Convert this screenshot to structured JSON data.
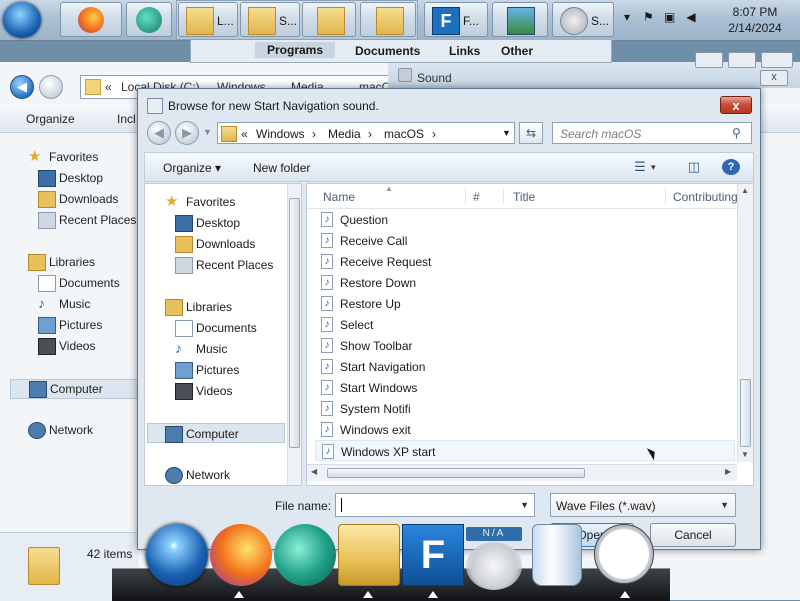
{
  "taskbar": {
    "buttons": [
      {
        "label": "L...",
        "icon": "folder-icon"
      },
      {
        "label": "S...",
        "icon": "folder-icon"
      },
      {
        "label": "",
        "icon": "folder-icon"
      },
      {
        "label": "",
        "icon": "folder-icon"
      },
      {
        "label": "F...",
        "icon": "app-f-icon"
      },
      {
        "label": "",
        "icon": "display-icon"
      },
      {
        "label": "S...",
        "icon": "speaker-icon"
      }
    ],
    "clock": {
      "time": "8:07 PM",
      "date": "2/14/2024"
    }
  },
  "jumpbar": {
    "items": [
      "Programs",
      "Documents",
      "Links",
      "Other"
    ]
  },
  "background_window": {
    "address": [
      "«",
      "Local Disk (C:)",
      "›",
      "Windows",
      "›",
      "Media",
      "›",
      "macOS"
    ],
    "toolbar": [
      "Organize",
      "Incl"
    ],
    "nav": [
      {
        "label": "Favorites",
        "icon": "star-icon"
      },
      {
        "label": "Desktop",
        "icon": "desktop-icon"
      },
      {
        "label": "Downloads",
        "icon": "downloads-icon"
      },
      {
        "label": "Recent Places",
        "icon": "recent-places-icon"
      },
      {
        "label": "Libraries",
        "icon": "libraries-icon"
      },
      {
        "label": "Documents",
        "icon": "documents-icon"
      },
      {
        "label": "Music",
        "icon": "music-icon"
      },
      {
        "label": "Pictures",
        "icon": "pictures-icon"
      },
      {
        "label": "Videos",
        "icon": "videos-icon"
      },
      {
        "label": "Computer",
        "icon": "computer-icon"
      },
      {
        "label": "Network",
        "icon": "network-icon"
      }
    ],
    "status": "42 items",
    "sound_panel_title": "Sound"
  },
  "dialog": {
    "title": "Browse for new Start Navigation sound.",
    "close": "x",
    "breadcrumb": [
      "«",
      "Windows",
      "›",
      "Media",
      "›",
      "macOS",
      "›"
    ],
    "search_placeholder": "Search macOS",
    "toolbar": {
      "organize": "Organize",
      "new_folder": "New folder"
    },
    "nav": [
      {
        "label": "Favorites",
        "icon": "star-icon"
      },
      {
        "label": "Desktop",
        "icon": "desktop-icon"
      },
      {
        "label": "Downloads",
        "icon": "downloads-icon"
      },
      {
        "label": "Recent Places",
        "icon": "recent-places-icon"
      },
      {
        "label": "Libraries",
        "icon": "libraries-icon"
      },
      {
        "label": "Documents",
        "icon": "documents-icon"
      },
      {
        "label": "Music",
        "icon": "music-icon"
      },
      {
        "label": "Pictures",
        "icon": "pictures-icon"
      },
      {
        "label": "Videos",
        "icon": "videos-icon"
      },
      {
        "label": "Computer",
        "icon": "computer-icon"
      },
      {
        "label": "Network",
        "icon": "network-icon"
      }
    ],
    "columns": [
      "Name",
      "#",
      "Title",
      "Contributing"
    ],
    "files": [
      "Question",
      "Receive Call",
      "Receive Request",
      "Restore Down",
      "Restore Up",
      "Select",
      "Show Toolbar",
      "Start Navigation",
      "Start Windows",
      "System Notifi",
      "Windows exit",
      "Windows XP start"
    ],
    "file_name_label": "File name:",
    "file_name_value": "",
    "filter": "Wave Files (*.wav)",
    "open_label": "Open",
    "cancel_label": "Cancel"
  },
  "dock": {
    "badge": "N/A",
    "items": [
      "windows-start-icon",
      "firefox-icon",
      "app-icon",
      "folder-icon",
      "app-f-icon",
      "gear-icon",
      "recycle-bin-icon",
      "clock-icon"
    ]
  }
}
